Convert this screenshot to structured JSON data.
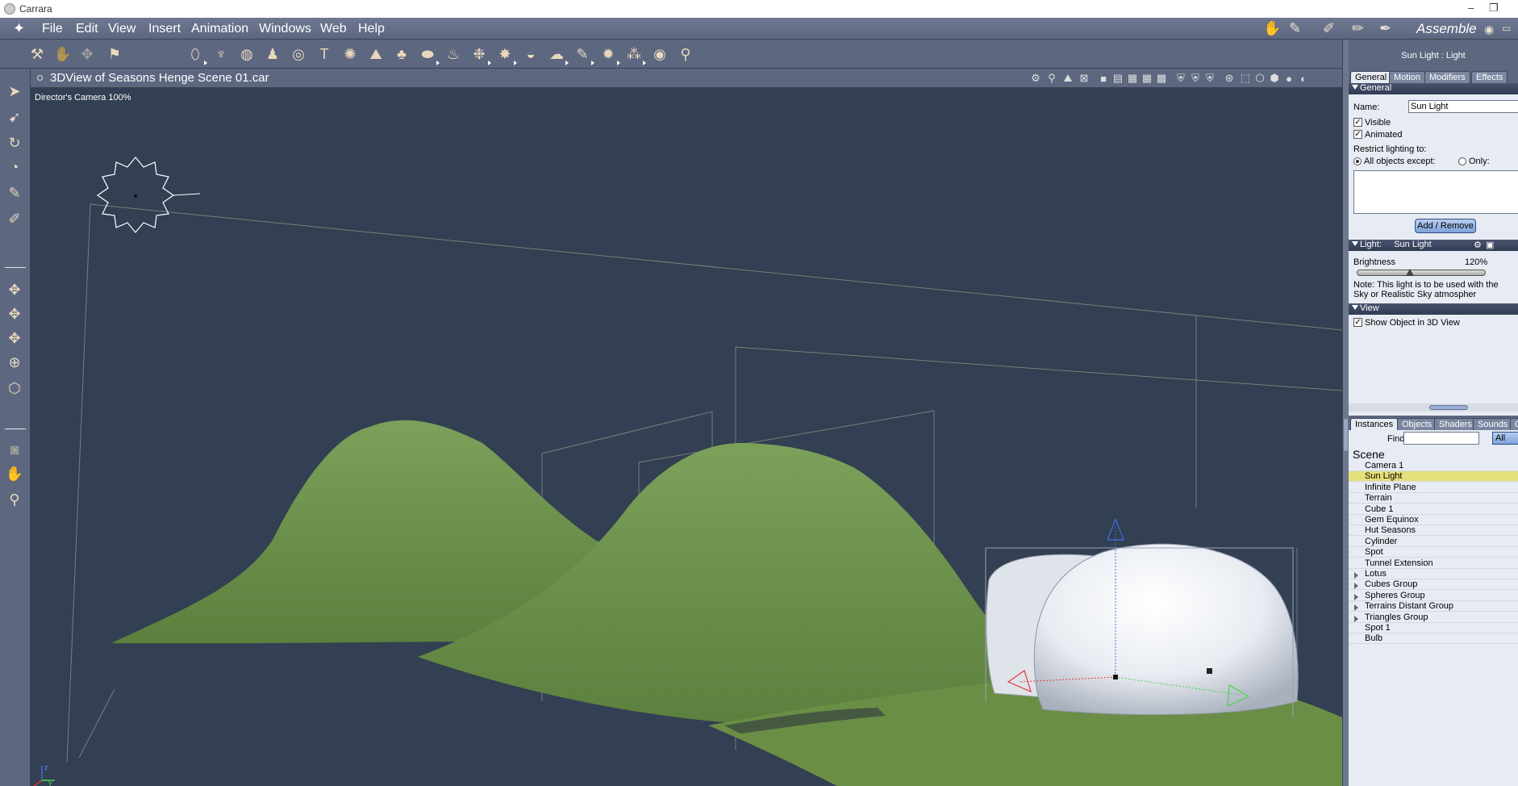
{
  "window": {
    "title": "Carrara",
    "minimize": "–",
    "restore": "❐"
  },
  "menubar": {
    "items": [
      "File",
      "Edit",
      "View",
      "Insert",
      "Animation",
      "Windows",
      "Web",
      "Help"
    ],
    "room": "Assemble"
  },
  "view": {
    "title": "3DView of Seasons Henge Scene 01.car",
    "camera_label": "Director's Camera 100%",
    "axis_labels": {
      "z": "z",
      "y": "y"
    }
  },
  "properties": {
    "header": "Sun Light : Light",
    "tabs": [
      "General",
      "Motion",
      "Modifiers",
      "Effects"
    ],
    "general": {
      "section": "General",
      "name_label": "Name:",
      "name_value": "Sun Light",
      "visible_label": "Visible",
      "animated_label": "Animated",
      "restrict_label": "Restrict lighting to:",
      "all_except_label": "All objects except:",
      "only_label": "Only:",
      "add_remove": "Add / Remove"
    },
    "light": {
      "section": "Light:",
      "type": "Sun Light",
      "brightness_label": "Brightness",
      "brightness_value": "120%",
      "brightness_level": 0.4,
      "note": "Note: This light is to be used with the Sky or Realistic Sky atmospher"
    },
    "view_section": {
      "section": "View",
      "show_label": "Show Object in 3D View"
    }
  },
  "browser": {
    "tabs": [
      "Instances",
      "Objects",
      "Shaders",
      "Sounds",
      "C"
    ],
    "find_label": "Find:",
    "find_value": "",
    "filter": "All",
    "scene_label": "Scene",
    "items": [
      {
        "label": "Camera 1",
        "group": false,
        "selected": false
      },
      {
        "label": "Sun Light",
        "group": false,
        "selected": true
      },
      {
        "label": "Infinite Plane",
        "group": false,
        "selected": false
      },
      {
        "label": "Terrain",
        "group": false,
        "selected": false
      },
      {
        "label": "Cube 1",
        "group": false,
        "selected": false
      },
      {
        "label": "Gem Equinox",
        "group": false,
        "selected": false
      },
      {
        "label": "Hut Seasons",
        "group": false,
        "selected": false
      },
      {
        "label": "Cylinder",
        "group": false,
        "selected": false
      },
      {
        "label": "Spot",
        "group": false,
        "selected": false
      },
      {
        "label": "Tunnel Extension",
        "group": false,
        "selected": false
      },
      {
        "label": "Lotus",
        "group": true,
        "selected": false
      },
      {
        "label": "Cubes Group",
        "group": true,
        "selected": false
      },
      {
        "label": "Spheres Group",
        "group": true,
        "selected": false
      },
      {
        "label": "Terrains Distant Group",
        "group": true,
        "selected": false
      },
      {
        "label": "Triangles Group",
        "group": true,
        "selected": false
      },
      {
        "label": "Spot 1",
        "group": false,
        "selected": false
      },
      {
        "label": "Bulb",
        "group": false,
        "selected": false
      }
    ]
  },
  "colors": {
    "viewport_bg": "#333f52",
    "terrain": "#6b8f4a",
    "selection": "#e4e07a"
  }
}
